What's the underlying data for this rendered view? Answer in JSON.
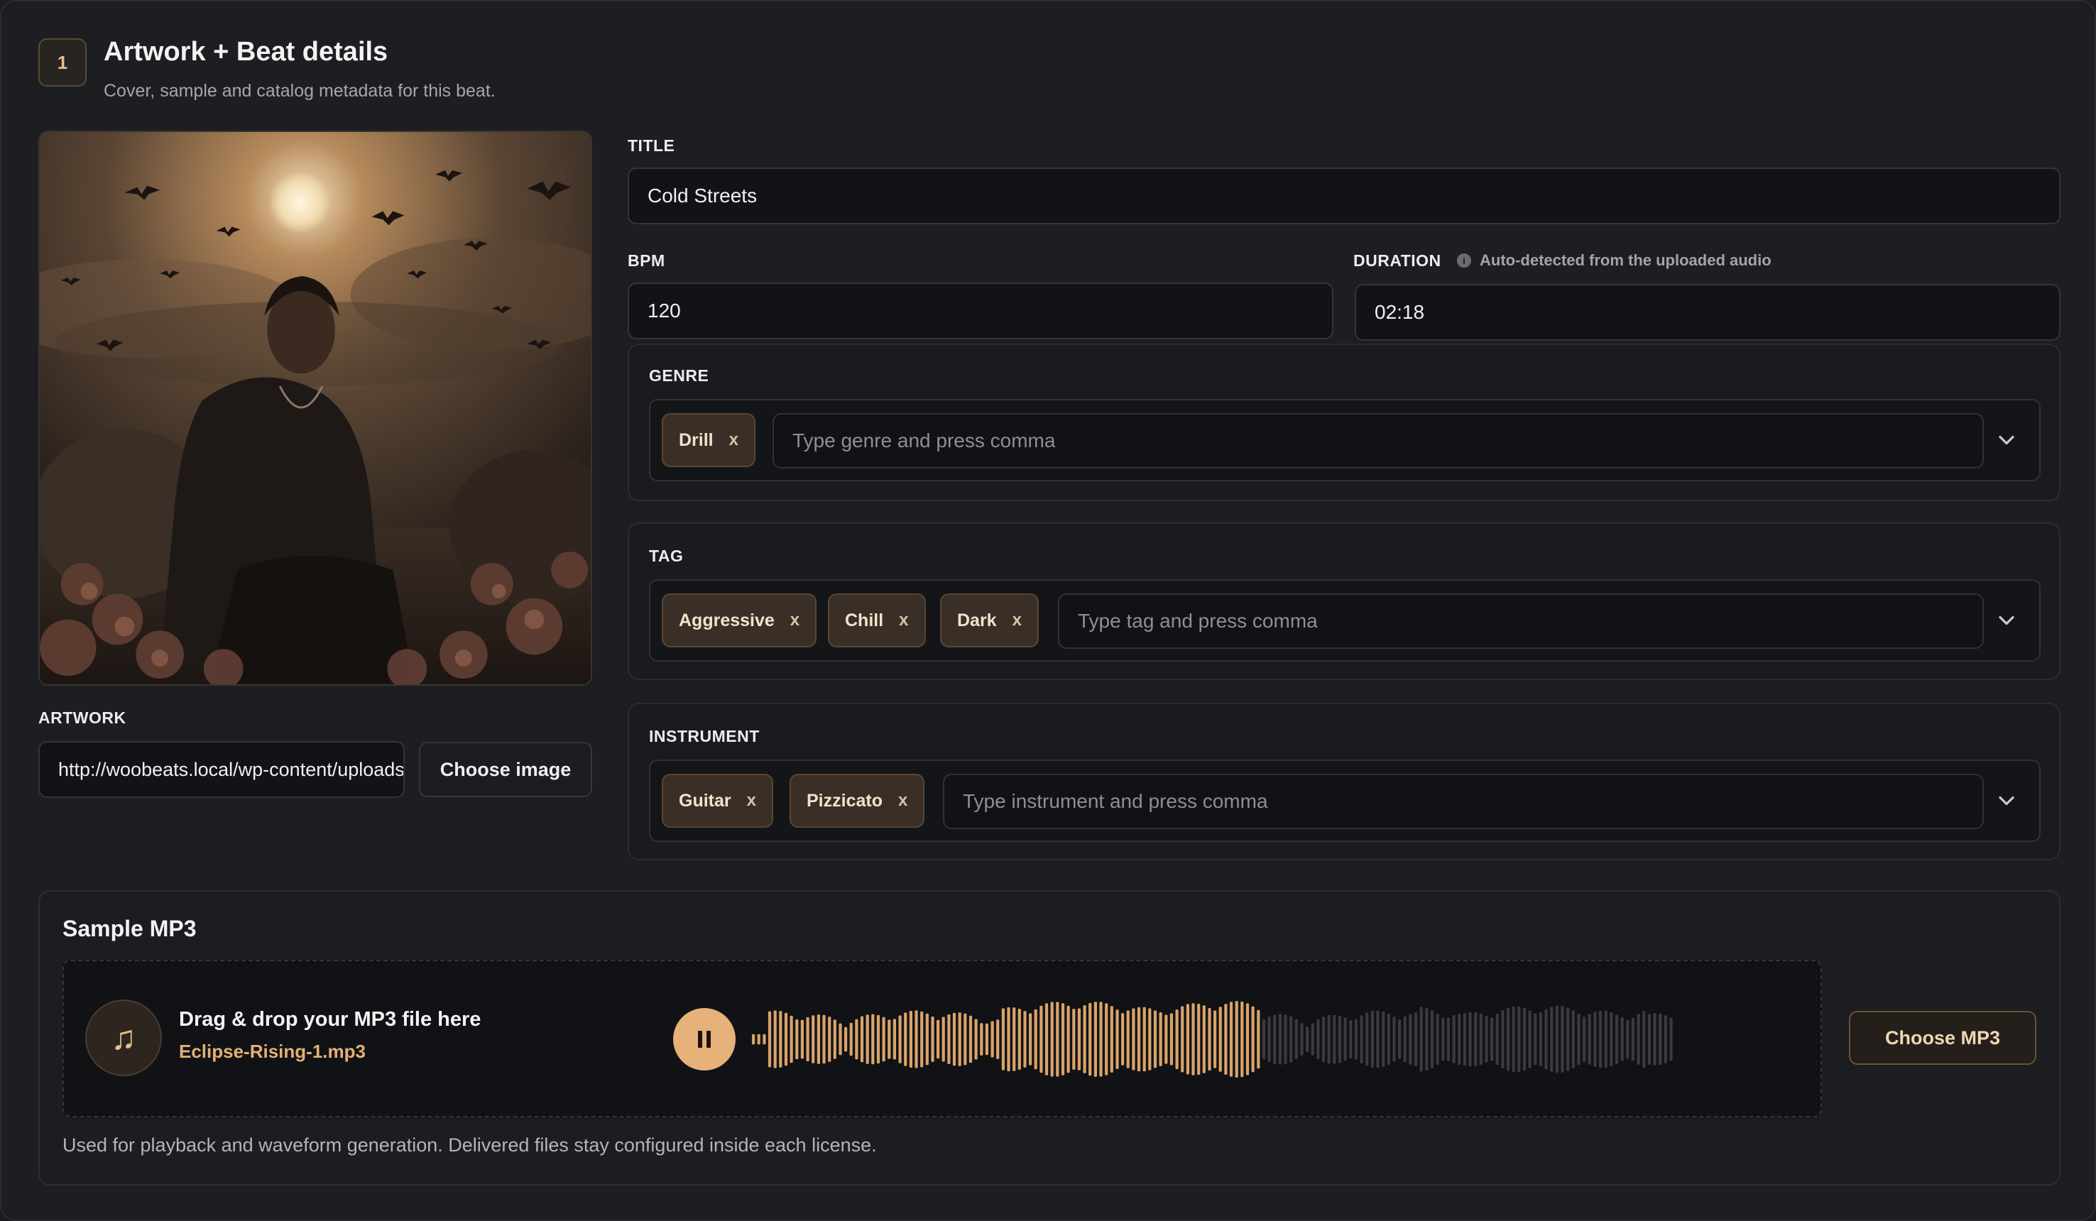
{
  "header": {
    "step": "1",
    "title": "Artwork + Beat details",
    "subtitle": "Cover, sample and catalog metadata for this beat."
  },
  "artwork": {
    "label": "ARTWORK",
    "url": "http://woobeats.local/wp-content/uploads/cold-streets.jpg",
    "choose_button": "Choose image"
  },
  "fields": {
    "title_label": "TITLE",
    "title_value": "Cold Streets",
    "bpm_label": "BPM",
    "bpm_value": "120",
    "duration_label": "DURATION",
    "duration_hint": "Auto-detected from the uploaded audio",
    "duration_value": "02:18"
  },
  "genre": {
    "label": "GENRE",
    "chips": [
      "Drill"
    ],
    "placeholder": "Type genre and press comma"
  },
  "tag": {
    "label": "TAG",
    "chips": [
      "Aggressive",
      "Chill",
      "Dark"
    ],
    "placeholder": "Type tag and press comma"
  },
  "instrument": {
    "label": "INSTRUMENT",
    "chips": [
      "Guitar",
      "Pizzicato"
    ],
    "placeholder": "Type instrument and press comma"
  },
  "chip_remove": "x",
  "sample": {
    "title": "Sample MP3",
    "drop_title": "Drag & drop your MP3 file here",
    "file_name": "Eclipse-Rising-1.mp3",
    "choose_button": "Choose MP3",
    "footnote": "Used for playback and waveform generation. Delivered files stay configured inside each license.",
    "playback_progress": 0.55
  },
  "colors": {
    "accent": "#e6b27a",
    "chip_bg": "#3a2f26",
    "wave_played": "#d9a36a",
    "wave_unplayed": "#3a3b40"
  },
  "icons": {
    "info": "info-icon",
    "music": "music-note-icon",
    "pause": "pause-icon",
    "chevron": "chevron-down-icon"
  }
}
